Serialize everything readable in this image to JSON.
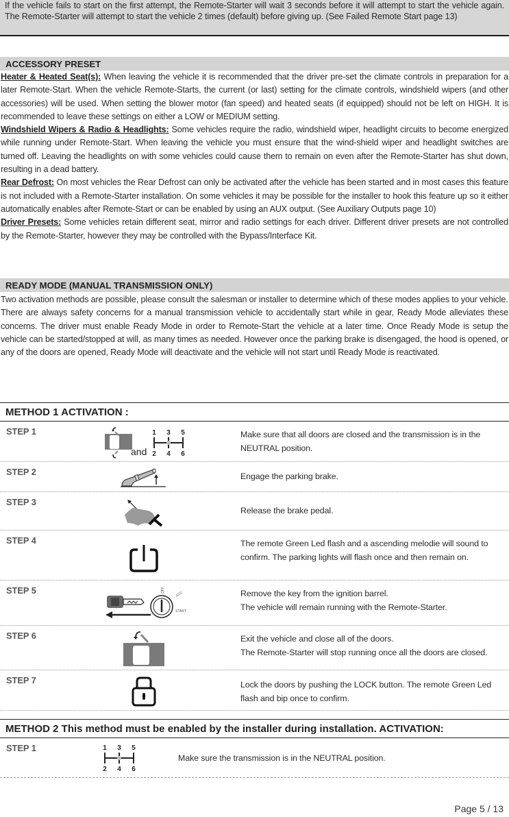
{
  "top_note": {
    "text": "If the vehicle fails to start on the first attempt, the Remote-Starter will wait 3 seconds before it will attempt to start the vehicle again. The Remote-Starter will attempt to start the vehicle 2 times (default) before giving up. (See Failed Remote Start page 13)"
  },
  "accessory_preset": {
    "heading": "ACCESSORY PRESET",
    "items": [
      {
        "lead": "Heater & Heated Seat(s):",
        "text": " When leaving the vehicle it is recommended that the driver pre-set the climate controls in preparation for a later Remote-Start. When the vehicle Remote-Starts, the current (or last) setting for the climate controls, windshield wipers (and other accessories) will be used. When setting the blower motor (fan speed) and heated seats (if equipped) should not be left on HIGH. It is recommended to leave these settings on either a LOW or MEDIUM setting."
      },
      {
        "lead": "Windshield Wipers & Radio & Headlights:",
        "text": " Some vehicles require the radio, windshield wiper, headlight circuits to become energized while running under Remote-Start. When leaving the vehicle you must ensure that the wind-shield wiper and headlight switches are turned off. Leaving the headlights on with some vehicles could cause them to remain on even after the Remote-Starter has shut down, resulting in a dead battery."
      },
      {
        "lead": "Rear Defrost:",
        "text": " On most vehicles the Rear Defrost can only be activated after the vehicle has been started and in most cases this feature is not included with a Remote-Starter installation. On some vehicles it may be possible for the installer to hook this feature up so it either automatically enables after Remote-Start or can be enabled by using an AUX output. (See Auxiliary Outputs page 10)"
      },
      {
        "lead": "Driver Presets:",
        "text": " Some vehicles retain different seat, mirror and radio settings for each driver. Different driver presets are not controlled by the Remote-Starter, however they may be controlled with the Bypass/Interface Kit."
      }
    ]
  },
  "ready_mode": {
    "heading": "READY MODE  (MANUAL TRANSMISSION ONLY)",
    "paragraphs": [
      "Two activation methods are possible, please consult the salesman or installer to determine which of these modes applies to your vehicle.",
      "There are always safety concerns for a manual transmission vehicle to accidentally start while in gear, Ready Mode alleviates these concerns. The driver must enable Ready Mode in order to Remote-Start the vehicle at a later time. Once Ready Mode is setup the vehicle can be started/stopped at will, as many times as needed. However once the parking brake is disengaged, the hood is opened, or any of the doors are opened, Ready Mode will deactivate and the vehicle will not start until Ready Mode is reactivated."
    ]
  },
  "method1": {
    "heading": "METHOD 1 ACTIVATION :",
    "and_label": "and",
    "gear_top": [
      "1",
      "3",
      "5"
    ],
    "gear_bottom": [
      "2",
      "4",
      "6"
    ],
    "ignition_labels": {
      "off": "OFF",
      "acc": "ACC",
      "start": "START"
    },
    "steps": [
      {
        "label": "STEP 1",
        "icon": "door-closed-and-gear-neutral-icon",
        "lines": [
          "Make sure that all doors are closed and the  transmission is in the NEUTRAL position."
        ]
      },
      {
        "label": "STEP 2",
        "icon": "parking-brake-icon",
        "lines": [
          "Engage the parking brake."
        ]
      },
      {
        "label": "STEP 3",
        "icon": "brake-pedal-release-icon",
        "lines": [
          "Release the brake pedal."
        ]
      },
      {
        "label": "STEP 4",
        "icon": "power-button-icon",
        "lines": [
          "The remote Green Led flash and a ascending melodie will sound to confirm. The parking lights will flash once and then remain on."
        ]
      },
      {
        "label": "STEP 5",
        "icon": "key-ignition-remove-icon",
        "lines": [
          "Remove the key from the ignition barrel.",
          "The vehicle will remain running with the Remote-Starter."
        ]
      },
      {
        "label": "STEP 6",
        "icon": "door-close-icon",
        "lines": [
          "Exit the vehicle and close all of the doors.",
          "The Remote-Starter will stop running once all the doors are closed."
        ]
      },
      {
        "label": "STEP 7",
        "icon": "lock-icon",
        "lines": [
          "Lock the doors by pushing the LOCK button. The remote Green Led flash and bip once to confirm."
        ]
      }
    ]
  },
  "method2": {
    "heading_bold": "METHOD 2",
    "heading_rest": " This method must be enabled by the installer during installation. ",
    "heading_end": "ACTIVATION:",
    "steps": [
      {
        "label": "STEP 1",
        "icon": "gear-neutral-icon",
        "lines": [
          "Make sure the transmission is in the NEUTRAL position."
        ]
      }
    ]
  },
  "footer": {
    "page": "Page 5 / 13"
  }
}
